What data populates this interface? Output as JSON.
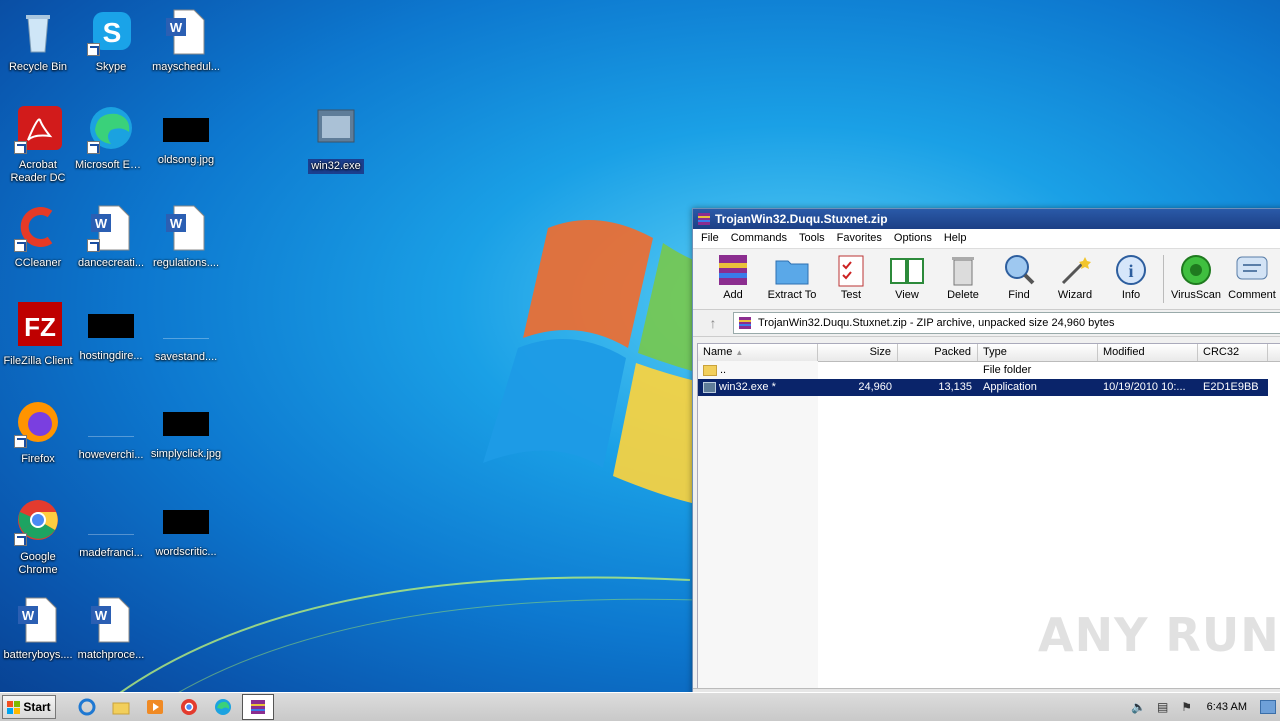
{
  "desktop": {
    "icons": [
      {
        "label": "Recycle Bin"
      },
      {
        "label": "Skype"
      },
      {
        "label": "mayschedul..."
      },
      {
        "label": "Acrobat Reader DC"
      },
      {
        "label": "Microsoft Edge"
      },
      {
        "label": "oldsong.jpg"
      },
      {
        "label": "win32.exe"
      },
      {
        "label": "CCleaner"
      },
      {
        "label": "dancecreati..."
      },
      {
        "label": "regulations...."
      },
      {
        "label": "FileZilla Client"
      },
      {
        "label": "hostingdire..."
      },
      {
        "label": "savestand...."
      },
      {
        "label": "Firefox"
      },
      {
        "label": "howeverchi..."
      },
      {
        "label": "simplyclick.jpg"
      },
      {
        "label": "Google Chrome"
      },
      {
        "label": "madefranci..."
      },
      {
        "label": "wordscritic..."
      },
      {
        "label": "batteryboys...."
      },
      {
        "label": "matchproce..."
      }
    ]
  },
  "winrar": {
    "title": "TrojanWin32.Duqu.Stuxnet.zip",
    "menu": [
      "File",
      "Commands",
      "Tools",
      "Favorites",
      "Options",
      "Help"
    ],
    "toolbar": [
      "Add",
      "Extract To",
      "Test",
      "View",
      "Delete",
      "Find",
      "Wizard",
      "Info",
      "VirusScan",
      "Comment"
    ],
    "address": "TrojanWin32.Duqu.Stuxnet.zip - ZIP archive, unpacked size 24,960 bytes",
    "columns": [
      "Name",
      "Size",
      "Packed",
      "Type",
      "Modified",
      "CRC32"
    ],
    "rows": [
      {
        "name": "..",
        "size": "",
        "packed": "",
        "type": "File folder",
        "modified": "",
        "crc": ""
      },
      {
        "name": "win32.exe *",
        "size": "24,960",
        "packed": "13,135",
        "type": "Application",
        "modified": "10/19/2010 10:...",
        "crc": "E2D1E9BB"
      }
    ]
  },
  "watermark": "ANY RUN",
  "taskbar": {
    "start_label": "Start",
    "clock": "6:43 AM"
  }
}
